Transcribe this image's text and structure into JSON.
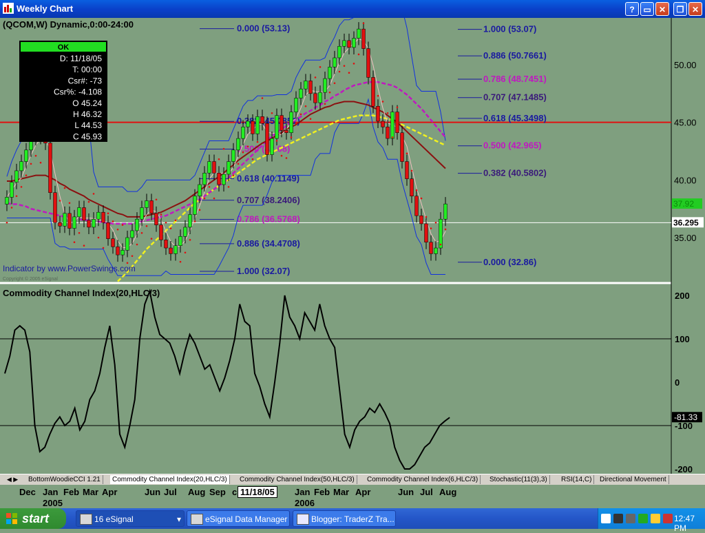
{
  "window": {
    "title": "Weekly Chart",
    "help": "?",
    "restore": "❐",
    "close": "✕"
  },
  "chart_header": {
    "symbol": "(QCOM,W) Dynamic,0:00-24:00"
  },
  "data_window": {
    "status": "OK",
    "rows": [
      "D: 11/18/05",
      "T: 00:00",
      "Csr#: -73",
      "Csr%: -4.108",
      "O 45.24",
      "H 46.32",
      "L 44.53",
      "C 45.93"
    ]
  },
  "price_axis": {
    "ticks": [
      "50.00",
      "45.00",
      "40.00",
      "35.00"
    ],
    "last_price": "37.92",
    "cursor_price": "36.295"
  },
  "fib_left": [
    {
      "ratio": "0.000",
      "value": "(53.13)",
      "color": "#1a1aa0"
    },
    {
      "ratio": "0.382",
      "value": "(45.0851)",
      "color": "#1a1aa0"
    },
    {
      "ratio": "0.500",
      "value": "(42.68)",
      "color": "#c018c0"
    },
    {
      "ratio": "0.618",
      "value": "(40.1149)",
      "color": "#1a1aa0"
    },
    {
      "ratio": "0.707",
      "value": "(38.2406)",
      "color": "#3a1a7a"
    },
    {
      "ratio": "0.786",
      "value": "(36.5768)",
      "color": "#c018c0"
    },
    {
      "ratio": "0.886",
      "value": "(34.4708)",
      "color": "#1a1aa0"
    },
    {
      "ratio": "1.000",
      "value": "(32.07)",
      "color": "#1a1aa0"
    }
  ],
  "fib_right": [
    {
      "ratio": "1.000",
      "value": "(53.07)",
      "color": "#1a1aa0"
    },
    {
      "ratio": "0.886",
      "value": "(50.7661)",
      "color": "#1a1aa0"
    },
    {
      "ratio": "0.786",
      "value": "(48.7451)",
      "color": "#c018c0"
    },
    {
      "ratio": "0.707",
      "value": "(47.1485)",
      "color": "#3a1a7a"
    },
    {
      "ratio": "0.618",
      "value": "(45.3498)",
      "color": "#1a1aa0"
    },
    {
      "ratio": "0.500",
      "value": "(42.965)",
      "color": "#c018c0"
    },
    {
      "ratio": "0.382",
      "value": "(40.5802)",
      "color": "#3a1a7a"
    },
    {
      "ratio": "0.000",
      "value": "(32.86)",
      "color": "#1a1aa0"
    }
  ],
  "indicator_credit": "Indicator by www.PowerSwings.com",
  "copyright": "Copyright © 2005 eSignal",
  "cci_panel": {
    "title": "Commodity Channel Index(20,HLC/3)",
    "ticks": [
      "200",
      "100",
      "0",
      "-100",
      "-200"
    ],
    "last_value": "-81.33"
  },
  "tabs": [
    "BottomWoodieCCI 1.21",
    "Commodity Channel Index(20,HLC/3)",
    "Commodity Channel Index(50,HLC/3)",
    "Commodity Channel Index(6,HLC/3)",
    "Stochastic(11(3),3)",
    "RSI(14,C)",
    "Directional Movement"
  ],
  "active_tab": 1,
  "x_axis": {
    "months": [
      "Dec",
      "Jan",
      "Feb",
      "Mar",
      "Apr",
      "Jun",
      "Jul",
      "Aug",
      "Sep",
      "c",
      "Jan",
      "Feb",
      "Mar",
      "Apr",
      "Jun",
      "Jul",
      "Aug"
    ],
    "years": [
      "2005",
      "2006"
    ],
    "cursor_date": "11/18/05"
  },
  "taskbar": {
    "start": "start",
    "tasks": [
      "16  eSignal",
      "eSignal Data Manager",
      "Blogger: TraderZ Tra..."
    ],
    "clock": "12:47 PM"
  },
  "colors": {
    "background": "#7f9f7f",
    "resistance_line": "#e01010",
    "ma_dark": "#8b1010",
    "ma_magenta": "#c018c0",
    "ma_yellow": "#f0f020",
    "band": "#1030e0",
    "cci": "#000000"
  },
  "chart_data": [
    {
      "type": "candlestick",
      "title": "(QCOM,W) Dynamic,0:00-24:00",
      "ylim": [
        31,
        53.5
      ],
      "y_ticks": [
        35,
        40,
        45,
        50
      ],
      "horizontal_lines": [
        {
          "value": 45.0,
          "color": "#e01010"
        },
        {
          "value": 36.295,
          "color": "#ffffff"
        }
      ],
      "closes": [
        38.5,
        39.8,
        40.8,
        41.6,
        42.6,
        43.6,
        44.3,
        43.7,
        43.2,
        38.9,
        36.3,
        36.0,
        37.1,
        35.8,
        36.8,
        37.6,
        36.5,
        35.9,
        36.6,
        37.2,
        36.3,
        34.9,
        34.2,
        33.5,
        33.9,
        35.0,
        35.6,
        36.6,
        37.6,
        38.2,
        37.1,
        36.1,
        34.8,
        34.1,
        33.6,
        34.3,
        35.1,
        35.9,
        37.0,
        38.6,
        39.6,
        40.6,
        41.6,
        40.6,
        39.6,
        40.5,
        41.6,
        42.6,
        43.6,
        44.6,
        45.1,
        44.0,
        45.5,
        44.9,
        42.2,
        43.6,
        45.6,
        44.3,
        44.1,
        45.9,
        47.1,
        47.9,
        48.6,
        47.5,
        46.7,
        47.6,
        48.8,
        49.8,
        50.6,
        51.6,
        52.1,
        51.5,
        52.3,
        53.1,
        51.4,
        48.9,
        46.4,
        45.1,
        44.6,
        43.6,
        45.9,
        44.1,
        41.6,
        40.1,
        38.6,
        36.9,
        36.2,
        34.6,
        33.6,
        34.1,
        36.6,
        37.92
      ],
      "ema_slow": [
        39.9,
        39.9,
        40.0,
        40.1,
        40.2,
        40.3,
        40.4,
        40.4,
        40.4,
        40.2,
        40.0,
        39.7,
        39.5,
        39.2,
        39.0,
        38.8,
        38.6,
        38.3,
        38.1,
        37.9,
        37.7,
        37.5,
        37.3,
        37.1,
        37.0,
        36.8,
        36.8,
        36.8,
        36.8,
        36.9,
        37.0,
        37.1,
        37.2,
        37.4,
        37.6,
        37.8,
        38.0,
        38.2,
        38.5,
        38.8,
        39.1,
        39.4,
        39.7,
        40.0,
        40.3,
        40.6,
        41.0,
        41.3,
        41.7,
        42.0,
        42.3,
        42.6,
        42.9,
        43.2,
        43.4,
        43.6,
        43.9,
        44.1,
        44.4,
        44.6,
        44.8,
        45.1,
        45.4,
        45.7,
        45.9,
        46.1,
        46.3,
        46.4,
        46.6,
        46.7,
        46.8,
        46.8,
        46.8,
        46.7,
        46.6,
        46.5,
        46.3,
        46.1,
        45.9,
        45.6,
        45.3,
        45.0,
        44.6,
        44.2,
        43.8,
        43.4,
        43.0,
        42.6,
        42.2,
        41.8,
        41.4,
        41.0
      ],
      "ema_mid": [
        38.0,
        37.9,
        37.9,
        37.8,
        37.7,
        37.5,
        37.4,
        37.3,
        37.2,
        37.1,
        37.0,
        36.9,
        36.8,
        36.7,
        36.6,
        36.6,
        36.5,
        36.5,
        36.4,
        36.4,
        36.3,
        36.3,
        36.2,
        36.2,
        36.2,
        36.2,
        36.2,
        36.3,
        36.4,
        36.5,
        36.6,
        36.7,
        36.8,
        36.9,
        37.1,
        37.3,
        37.5,
        37.7,
        37.9,
        38.1,
        38.3,
        38.6,
        38.9,
        39.2,
        39.5,
        39.8,
        40.2,
        40.6,
        41.0,
        41.4,
        41.8,
        42.2,
        42.6,
        43.0,
        43.4,
        43.8,
        44.1,
        44.4,
        44.7,
        45.0,
        45.2,
        45.5,
        45.8,
        46.0,
        46.3,
        46.5,
        46.8,
        47.0,
        47.3,
        47.5,
        47.8,
        48.0,
        48.2,
        48.3,
        48.4,
        48.5,
        48.5,
        48.5,
        48.4,
        48.3,
        48.2,
        48.0,
        47.7,
        47.4,
        47.0,
        46.6,
        46.2,
        45.7,
        45.2,
        44.7,
        44.2,
        43.7
      ],
      "ema_fast": [
        null,
        null,
        null,
        null,
        null,
        null,
        null,
        null,
        null,
        null,
        null,
        null,
        null,
        null,
        null,
        null,
        null,
        null,
        null,
        null,
        null,
        null,
        null,
        31.2,
        31.6,
        32.0,
        32.5,
        33.0,
        33.5,
        34.0,
        34.4,
        34.8,
        35.2,
        35.6,
        36.0,
        36.4,
        36.8,
        37.2,
        37.6,
        38.0,
        38.3,
        38.6,
        38.9,
        39.2,
        39.5,
        39.8,
        40.0,
        40.3,
        40.6,
        40.9,
        41.2,
        41.5,
        41.8,
        42.0,
        42.2,
        42.4,
        42.6,
        42.8,
        43.0,
        43.2,
        43.4,
        43.6,
        43.8,
        44.0,
        44.2,
        44.4,
        44.6,
        44.8,
        45.0,
        45.2,
        45.3,
        45.4,
        45.5,
        45.6,
        45.6,
        45.6,
        45.6,
        45.5,
        45.4,
        45.3,
        45.2,
        45.0,
        44.8,
        44.6,
        44.4,
        44.2,
        44.0,
        43.8,
        43.6,
        43.4,
        43.2,
        43.0
      ]
    },
    {
      "type": "line",
      "title": "Commodity Channel Index(20,HLC/3)",
      "ylim": [
        -250,
        250
      ],
      "y_ticks": [
        200,
        100,
        0,
        -100,
        -200
      ],
      "reference_lines": [
        100,
        -100
      ],
      "values": [
        20,
        60,
        120,
        130,
        120,
        70,
        -100,
        -160,
        -150,
        -120,
        -95,
        -80,
        -100,
        -90,
        -60,
        -110,
        -90,
        -40,
        -20,
        20,
        80,
        130,
        40,
        -120,
        -150,
        -100,
        -40,
        100,
        180,
        210,
        150,
        110,
        100,
        90,
        60,
        20,
        70,
        110,
        90,
        60,
        30,
        40,
        10,
        -20,
        10,
        50,
        100,
        180,
        140,
        130,
        20,
        -10,
        -50,
        -80,
        0,
        90,
        200,
        150,
        130,
        100,
        160,
        140,
        120,
        180,
        130,
        100,
        80,
        -20,
        -120,
        -150,
        -110,
        -90,
        -80,
        -60,
        -70,
        -50,
        -70,
        -95,
        -150,
        -180,
        -200,
        -200,
        -190,
        -170,
        -150,
        -140,
        -120,
        -100,
        -90,
        -81.33
      ]
    }
  ]
}
